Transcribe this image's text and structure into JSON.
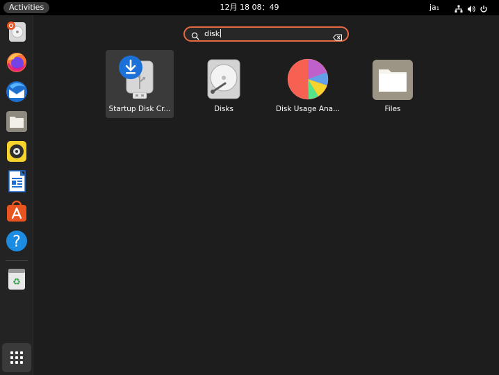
{
  "topbar": {
    "activities_label": "Activities",
    "clock": "12月 18 08：49",
    "input_method": "ja₁",
    "tray_icons": [
      "network-icon",
      "volume-icon",
      "power-icon"
    ]
  },
  "dock": {
    "items": [
      {
        "name": "ubuntu-software-updater",
        "icon": "updater-icon"
      },
      {
        "name": "firefox",
        "icon": "firefox-icon"
      },
      {
        "name": "thunderbird",
        "icon": "thunderbird-icon"
      },
      {
        "name": "files",
        "icon": "folder-icon"
      },
      {
        "name": "rhythmbox",
        "icon": "rhythmbox-icon"
      },
      {
        "name": "libreoffice-writer",
        "icon": "writer-icon"
      },
      {
        "name": "app-center",
        "icon": "app-center-icon"
      },
      {
        "name": "help",
        "icon": "help-icon"
      },
      {
        "name": "trash",
        "icon": "trash-icon"
      }
    ],
    "show_apps_icon": "app-grid-icon"
  },
  "search": {
    "value": "disk",
    "focus_color": "#e56a42"
  },
  "results": [
    {
      "label": "Startup Disk Cr...",
      "icon": "startup-disk-creator-icon",
      "selected": true
    },
    {
      "label": "Disks",
      "icon": "disks-icon",
      "selected": false
    },
    {
      "label": "Disk Usage Ana...",
      "icon": "disk-usage-analyzer-icon",
      "selected": false
    },
    {
      "label": "Files",
      "icon": "files-folder-icon",
      "selected": false
    }
  ]
}
